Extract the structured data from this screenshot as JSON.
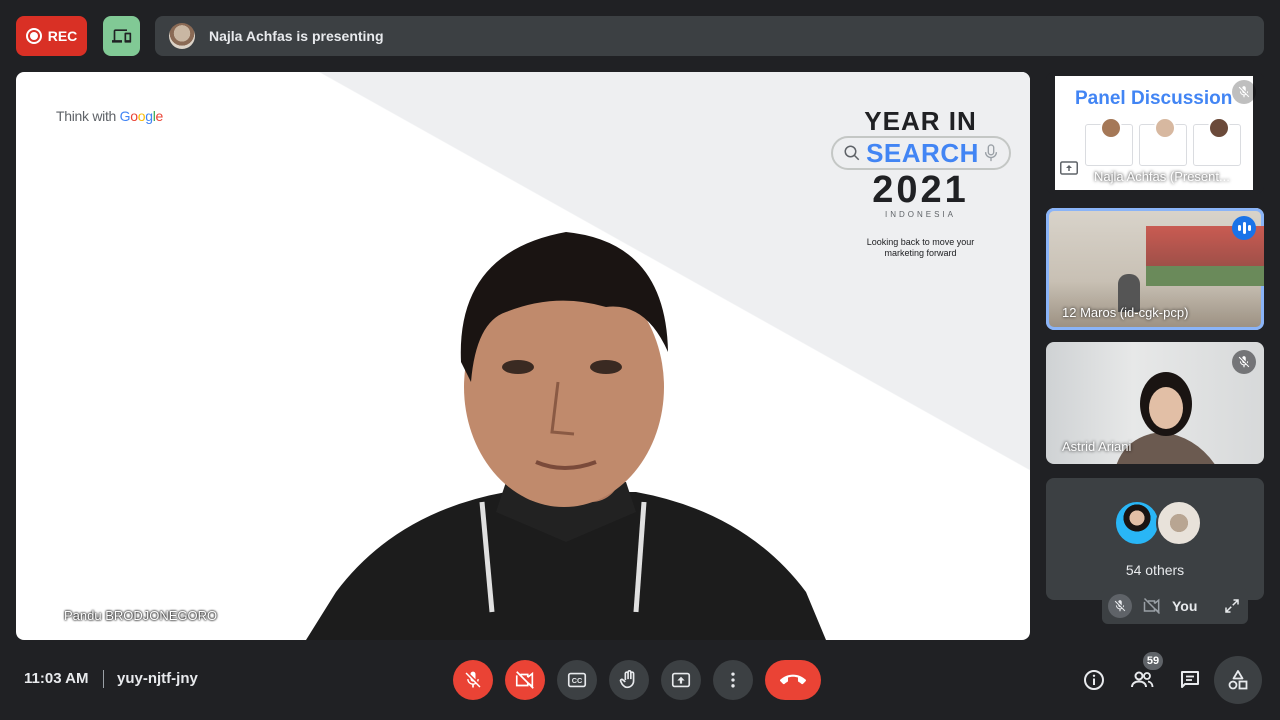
{
  "top": {
    "rec_label": "REC",
    "presenting": "Najla Achfas is presenting"
  },
  "stage": {
    "brand_prefix": "Think with ",
    "brand_g": [
      "G",
      "o",
      "o",
      "g",
      "l",
      "e"
    ],
    "slide_line1": "YEAR IN",
    "slide_search": "SEARCH",
    "slide_year": "2021",
    "slide_country": "INDONESIA",
    "slide_tagline1": "Looking back to move your",
    "slide_tagline2": "marketing forward",
    "speaker_name": "Pandu BRODJONEGORO"
  },
  "tiles": {
    "t1": {
      "slide_title": "Panel Discussion",
      "label": "Najla Achfas (Present..."
    },
    "t2": {
      "label": "12 Maros (id-cgk-pcp)"
    },
    "t3": {
      "label": "Astrid Ariani"
    },
    "t4": {
      "others": "54 others"
    },
    "self": {
      "label": "You"
    }
  },
  "bottom": {
    "time": "11:03 AM",
    "meeting_code": "yuy-njtf-jny",
    "participants_count": "59"
  },
  "colors": {
    "rec": "#d93025",
    "danger": "#ea4335",
    "accent": "#8ab4f8",
    "device_btn": "#81c995",
    "surface": "#3c4043",
    "background": "#202124"
  },
  "icons": {
    "rec": "record-icon",
    "device": "devices-icon",
    "mic_off": "mic-off-icon",
    "cam_off": "videocam-off-icon",
    "captions": "closed-caption-icon",
    "hand": "raise-hand-icon",
    "present": "present-screen-icon",
    "more": "more-vert-icon",
    "end": "call-end-icon",
    "info": "info-icon",
    "people": "people-icon",
    "chat": "chat-icon",
    "activities": "activities-icon",
    "expand": "expand-icon"
  }
}
